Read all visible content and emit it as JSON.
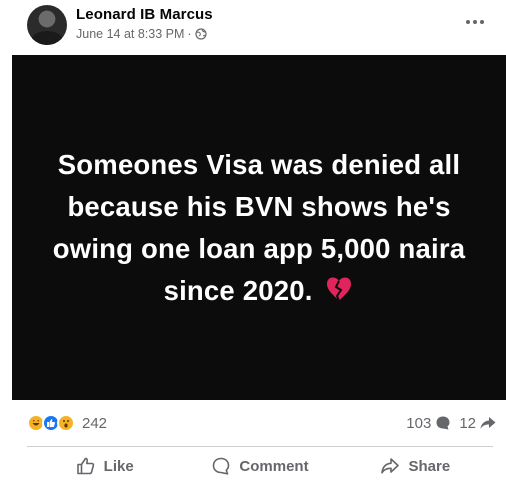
{
  "post": {
    "author": "Leonard IB Marcus",
    "timestamp": "June 14 at 8:33 PM",
    "separator": "·",
    "privacy_icon": "globe-icon",
    "more_icon": "ellipsis-icon",
    "image_text": "Someones Visa was denied all because his BVN shows he's owing one loan app 5,000 naira since 2020.",
    "image_emoji": "broken-heart-icon",
    "image_background": "#0c0c0c"
  },
  "reactions": {
    "types": [
      "haha",
      "like",
      "wow"
    ],
    "count": "242"
  },
  "stats": {
    "comments": "103",
    "shares": "12"
  },
  "actions": {
    "like": "Like",
    "comment": "Comment",
    "share": "Share"
  },
  "colors": {
    "secondary_text": "#65676b",
    "like_blue": "#1877f2",
    "reaction_yellow": "#f7b125",
    "heart_red": "#e0245e"
  }
}
